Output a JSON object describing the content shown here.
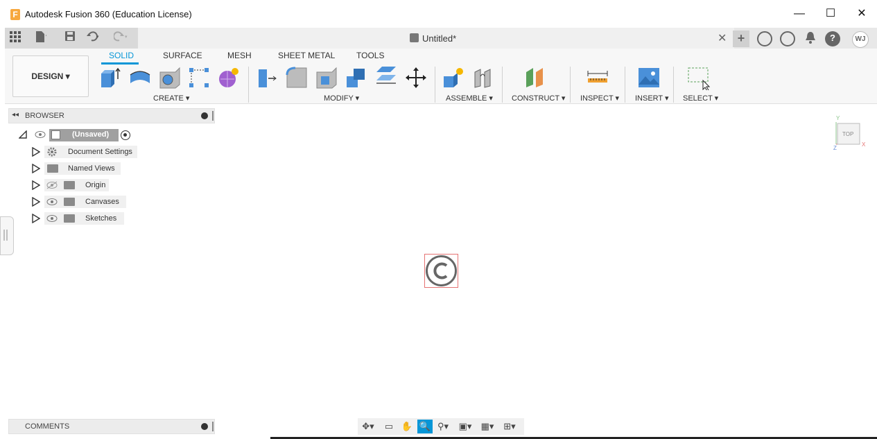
{
  "window": {
    "title": "Autodesk Fusion 360 (Education License)",
    "app_icon_letter": "F",
    "minimize_glyph": "—",
    "maximize_glyph": "☐",
    "close_glyph": "✕"
  },
  "quick_access": {
    "icons": [
      "grid-icon",
      "file-icon",
      "save-icon",
      "undo-icon",
      "redo-icon"
    ]
  },
  "document_tab": {
    "title": "Untitled*",
    "close_glyph": "✕"
  },
  "right_icons": {
    "add": "+",
    "user_initials": "WJ",
    "help": "?"
  },
  "workspace": {
    "design_label": "DESIGN ▾",
    "tabs": [
      "SOLID",
      "SURFACE",
      "MESH",
      "SHEET METAL",
      "TOOLS"
    ],
    "active_tab": "SOLID"
  },
  "tool_groups": {
    "create": "CREATE ▾",
    "modify": "MODIFY ▾",
    "assemble": "ASSEMBLE ▾",
    "construct": "CONSTRUCT ▾",
    "inspect": "INSPECT ▾",
    "insert": "INSERT ▾",
    "select": "SELECT ▾"
  },
  "browser": {
    "header": "BROWSER",
    "root": "(Unsaved)",
    "items": [
      {
        "label": "Document Settings",
        "icon": "gear-icon"
      },
      {
        "label": "Named Views",
        "icon": "folder-icon"
      },
      {
        "label": "Origin",
        "icon": "folder-icon"
      },
      {
        "label": "Canvases",
        "icon": "folder-icon"
      },
      {
        "label": "Sketches",
        "icon": "folder-icon"
      }
    ]
  },
  "comments": {
    "header": "COMMENTS"
  },
  "viewcube": {
    "face": "TOP",
    "axis_x": "X",
    "axis_y": "Y",
    "axis_z": "Z"
  },
  "colors": {
    "accent": "#0696d7",
    "tool_blue": "#4a90d9",
    "construct_green": "#5aa05a",
    "construct_orange": "#e8914a"
  }
}
